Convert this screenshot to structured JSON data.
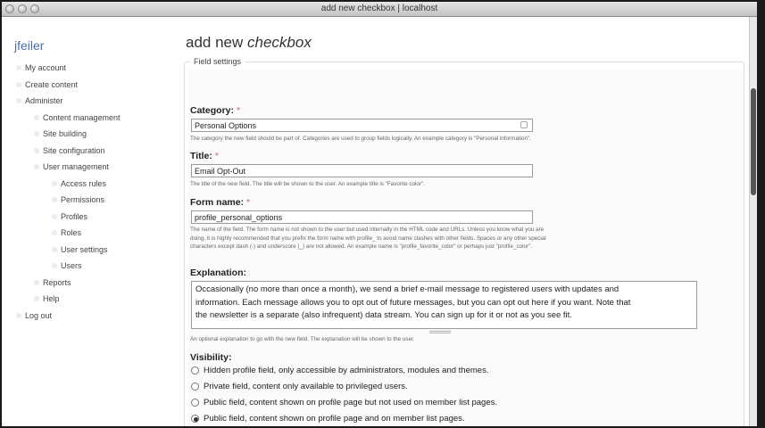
{
  "window": {
    "title": "add new checkbox | localhost"
  },
  "sidebar": {
    "user": "jfeiler",
    "items": [
      {
        "label": "My account",
        "level": 1
      },
      {
        "label": "Create content",
        "level": 1
      },
      {
        "label": "Administer",
        "level": 1
      },
      {
        "label": "Content management",
        "level": 2
      },
      {
        "label": "Site building",
        "level": 2
      },
      {
        "label": "Site configuration",
        "level": 2
      },
      {
        "label": "User management",
        "level": 2
      },
      {
        "label": "Access rules",
        "level": 3
      },
      {
        "label": "Permissions",
        "level": 3
      },
      {
        "label": "Profiles",
        "level": 3
      },
      {
        "label": "Roles",
        "level": 3
      },
      {
        "label": "User settings",
        "level": 3
      },
      {
        "label": "Users",
        "level": 3
      },
      {
        "label": "Reports",
        "level": 2
      },
      {
        "label": "Help",
        "level": 2
      },
      {
        "label": "Log out",
        "level": 1
      }
    ]
  },
  "page": {
    "title_prefix": "add new ",
    "title_em": "checkbox"
  },
  "fieldset": {
    "legend": "Field settings"
  },
  "category": {
    "label": "Category:",
    "required": "*",
    "value": "Personal Options",
    "desc": "The category the new field should be part of. Categories are used to group fields logically. An example category is \"Personal information\"."
  },
  "title_field": {
    "label": "Title:",
    "required": "*",
    "value": "Email Opt-Out",
    "desc": "The title of the new field. The title will be shown to the user. An example title is \"Favorite color\"."
  },
  "form_name": {
    "label": "Form name:",
    "required": "*",
    "value": "profile_personal_options",
    "desc_1": "The name of the field. The form name is not shown to the user but used internally in the HTML code and URLs. Unless you know what you are",
    "desc_2": "doing, it is highly recommended that you prefix the form name with profile_ to avoid name clashes with other fields. Spaces or any other special",
    "desc_3": "characters except dash (-) and underscore (_) are not allowed. An example name is \"profile_favorite_color\" or perhaps just \"profile_color\"."
  },
  "explanation": {
    "label": "Explanation:",
    "line_1": "Occasionally (no more than once a month), we send a brief e-mail message to registered users with updates and",
    "line_2": "information. Each message allows you to opt out of future messages, but you can opt out here if you want. Note that",
    "line_3": "the newsletter is a separate (also infrequent) data stream. You can sign up for it or not as you see fit.",
    "desc": "An optional explanation to go with the new field. The explanation will be shown to the user."
  },
  "visibility": {
    "label": "Visibility:",
    "options": [
      {
        "label": "Hidden profile field, only accessible by administrators, modules and themes.",
        "checked": false
      },
      {
        "label": "Private field, content only available to privileged users.",
        "checked": false
      },
      {
        "label": "Public field, content shown on profile page but not used on member list pages.",
        "checked": false
      },
      {
        "label": "Public field, content shown on profile page and on member list pages.",
        "checked": true
      }
    ]
  }
}
